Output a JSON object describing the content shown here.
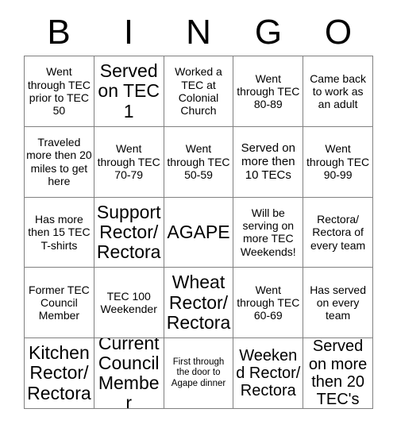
{
  "card": {
    "title_letters": [
      "B",
      "I",
      "N",
      "G",
      "O"
    ],
    "grid_size": "5x5",
    "border_color": "#808080",
    "text_color": "#000000",
    "background_color": "#ffffff",
    "rows": [
      [
        {
          "text": "Went through TEC prior to TEC 50",
          "size": "sm"
        },
        {
          "text": "Served on TEC 1",
          "size": "xl"
        },
        {
          "text": "Worked a TEC at Colonial Church",
          "size": "sm"
        },
        {
          "text": "Went through TEC 80-89",
          "size": "sm"
        },
        {
          "text": "Came back to work as an adult",
          "size": "sm"
        }
      ],
      [
        {
          "text": "Traveled more then 20 miles to get here",
          "size": "sm"
        },
        {
          "text": "Went through TEC 70-79",
          "size": "sm"
        },
        {
          "text": "Went through TEC 50-59",
          "size": "sm"
        },
        {
          "text": "Served on more then 10 TECs",
          "size": "md"
        },
        {
          "text": "Went through TEC 90-99",
          "size": "sm"
        }
      ],
      [
        {
          "text": "Has more then 15 TEC T-shirts",
          "size": "sm"
        },
        {
          "text": "Support Rector/ Rectora",
          "size": "xl"
        },
        {
          "text": "AGAPE",
          "size": "xl"
        },
        {
          "text": "Will be serving on more TEC Weekends!",
          "size": "sm"
        },
        {
          "text": "Rectora/ Rectora of every team",
          "size": "sm"
        }
      ],
      [
        {
          "text": "Former TEC Council Member",
          "size": "sm"
        },
        {
          "text": "TEC 100 Weekender",
          "size": "sm"
        },
        {
          "text": "Wheat Rector/ Rectora",
          "size": "xl"
        },
        {
          "text": "Went through TEC 60-69",
          "size": "sm"
        },
        {
          "text": "Has served on every team",
          "size": "sm"
        }
      ],
      [
        {
          "text": "Kitchen Rector/ Rectora",
          "size": "xl"
        },
        {
          "text": "Current Council Member",
          "size": "xl"
        },
        {
          "text": "First through the door to Agape dinner",
          "size": "xs"
        },
        {
          "text": "Weekend Rector/ Rectora",
          "size": "lg"
        },
        {
          "text": "Served on more then 20 TEC's",
          "size": "lg"
        }
      ]
    ]
  }
}
